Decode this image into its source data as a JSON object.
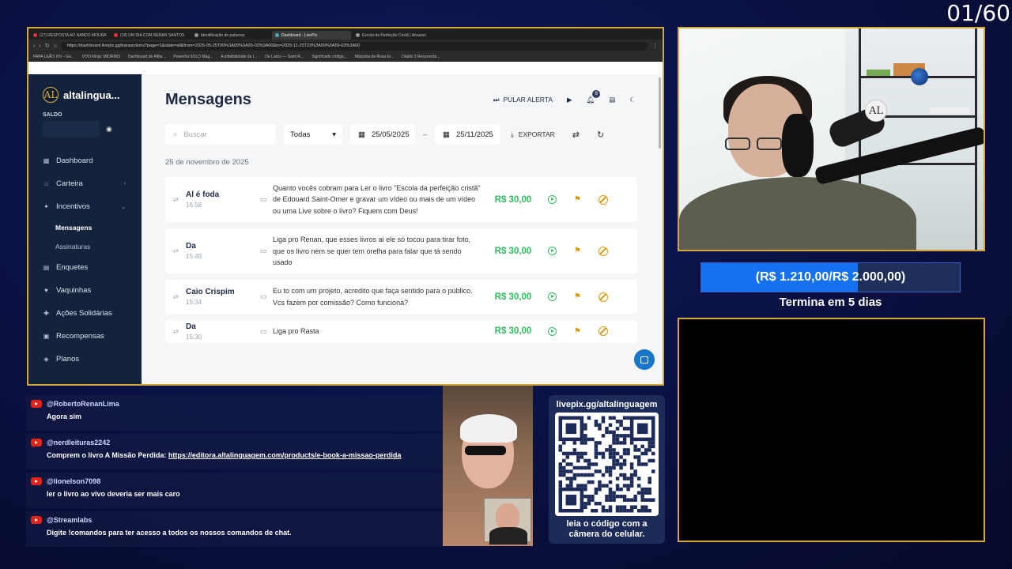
{
  "overlay": {
    "counter": "01/60",
    "progress_label": "(R$ 1.210,00/R$ 2.000,00)",
    "progress_fraction": 0.605,
    "termina": "Termina em 5 dias"
  },
  "browser": {
    "tabs": [
      {
        "label": "(17) RESPOSTA AO NANDO MOURA",
        "active": false
      },
      {
        "label": "(18) UM DIA COM RENAN SANTOS",
        "active": false
      },
      {
        "label": "Identificação de palavras",
        "active": false
      },
      {
        "label": "Dashboard - LivePix",
        "active": true
      },
      {
        "label": "Escola da Perfeição Cristã | Amazon",
        "active": false
      }
    ],
    "url": "https://dashboard.livepix.gg/transactions?page=1&state=all&from=2025-05-25T00%3A00%3A00-03%3A00&to=2025-11-25T23%3A59%3A59-03%3A00",
    "bookmarks": [
      "PAPA LEÃO XIV - Go...",
      "VOO.Ninja: MIORIM3",
      "Dashboard de Afilia...",
      "Powerful SOLO Mag...",
      "A infalibilidade da I...",
      "De Laicis — Saint R...",
      "Significado código...",
      "Máquina de Rosa El...",
      "Diablo 2 Resurrecte..."
    ]
  },
  "sidebar": {
    "logo_mark": "AL",
    "brand": "altalingua...",
    "saldo_label": "SALDO",
    "items": [
      {
        "label": "Dashboard",
        "icon": "▦"
      },
      {
        "label": "Carteira",
        "icon": "⌂",
        "chevron": "›"
      },
      {
        "label": "Incentivos",
        "icon": "✦",
        "chevron": "⌄"
      }
    ],
    "sub_items": [
      "Mensagens",
      "Assinaturas"
    ],
    "items2": [
      {
        "label": "Enquetes",
        "icon": "▤"
      },
      {
        "label": "Vaquinhas",
        "icon": "♥"
      },
      {
        "label": "Ações Solidárias",
        "icon": "✚"
      },
      {
        "label": "Recompensas",
        "icon": "▣"
      },
      {
        "label": "Planos",
        "icon": "◈"
      }
    ]
  },
  "main": {
    "title": "Mensagens",
    "pular_alerta": "PULAR ALERTA",
    "notification_count": "6",
    "search_placeholder": "Buscar",
    "filter_select": "Todas",
    "date_from": "25/05/2025",
    "date_sep": "–",
    "date_to": "25/11/2025",
    "export": "EXPORTAR",
    "date_heading": "25 de novembro de 2025",
    "messages": [
      {
        "name": "Al é foda",
        "time": "16:58",
        "text": "Quanto vocês cobram para Ler o livro \"Escola da perfeição cristã\" de Edouard Saint-Omer e gravar um vídeo ou mais de um vídeo ou uma Live sobre o livro? Fiquem com Deus!",
        "amount": "R$ 30,00"
      },
      {
        "name": "Da",
        "time": "15:49",
        "text": "Liga pro Renan, que esses livros ai ele só tocou para tirar foto, que os livro nem se quer tem orelha para falar que tá sendo usado",
        "amount": "R$ 30,00"
      },
      {
        "name": "Caio Crispim",
        "time": "15:34",
        "text": "Eu to com um projeto, acredito que faça sentido para o público. Vcs fazem por comissão? Como funciona?",
        "amount": "R$ 30,00"
      },
      {
        "name": "Da",
        "time": "15:30",
        "text": "Liga pro Rasta",
        "amount": "R$ 30,00"
      }
    ]
  },
  "chat": [
    {
      "user": "@RobertoRenanLima",
      "message": "Agora sim"
    },
    {
      "user": "@nerdleituras2242",
      "message": "Comprem o livro A Missão Perdida: ",
      "link": "https://editora.altalinguagem.com/products/e-book-a-missao-perdida"
    },
    {
      "user": "@lionelson7098",
      "message": "ler o livro ao vivo deveria ser mais caro"
    },
    {
      "user": "@Streamlabs",
      "message": "Digite !comandos para ter acesso a todos os nossos comandos de chat."
    }
  ],
  "qr": {
    "url": "livepix.gg/altalinguagem",
    "caption_line1": "leia o código com a",
    "caption_line2": "câmera do celular."
  },
  "webcam": {
    "mic_logo": "AL"
  }
}
